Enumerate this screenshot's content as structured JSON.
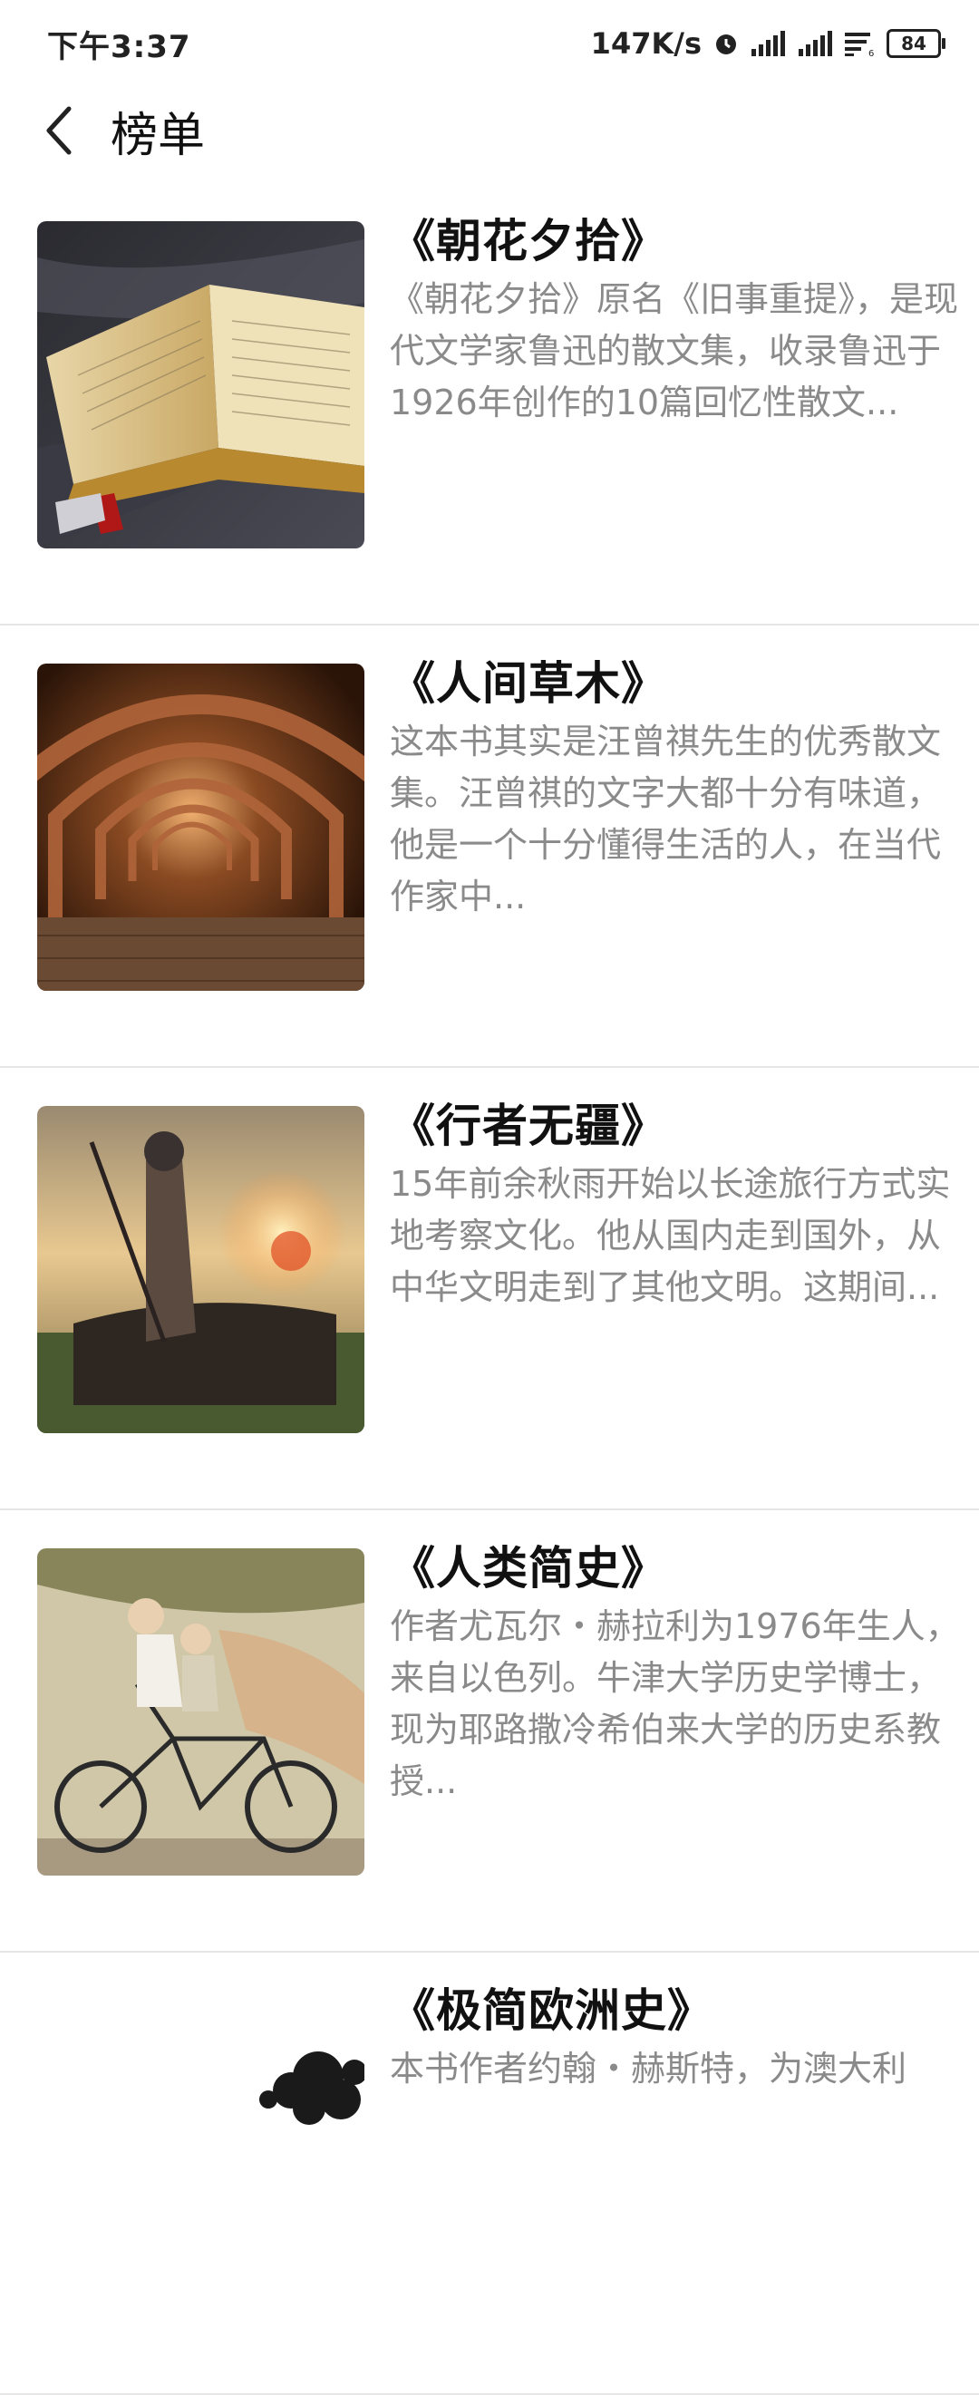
{
  "status_bar": {
    "time": "下午3:37",
    "net_speed": "147K/s",
    "battery": "84",
    "icons": [
      "alarm-icon",
      "signal-icon",
      "signal-icon",
      "wifi-icon",
      "battery-icon"
    ]
  },
  "header": {
    "back_icon": "chevron-left-icon",
    "title": "榜单"
  },
  "books": [
    {
      "title": "《朝花夕拾》",
      "desc": "《朝花夕拾》原名《旧事重提》，是现代文学家鲁迅的散文集，收录鲁迅于1926年创作的10篇回忆性散文..."
    },
    {
      "title": "《人间草木》",
      "desc": "这本书其实是汪曾祺先生的优秀散文集。汪曾祺的文字大都十分有味道，他是一个十分懂得生活的人，在当代作家中..."
    },
    {
      "title": "《行者无疆》",
      "desc": "15年前余秋雨开始以长途旅行方式实地考察文化。他从国内走到国外，从中华文明走到了其他文明。这期间..."
    },
    {
      "title": "《人类简史》",
      "desc": "作者尤瓦尔・赫拉利为1976年生人，来自以色列。牛津大学历史学博士，现为耶路撒冷希伯来大学的历史系教授..."
    },
    {
      "title": "《极简欧洲史》",
      "desc": "本书作者约翰・赫斯特，为澳大利"
    }
  ]
}
